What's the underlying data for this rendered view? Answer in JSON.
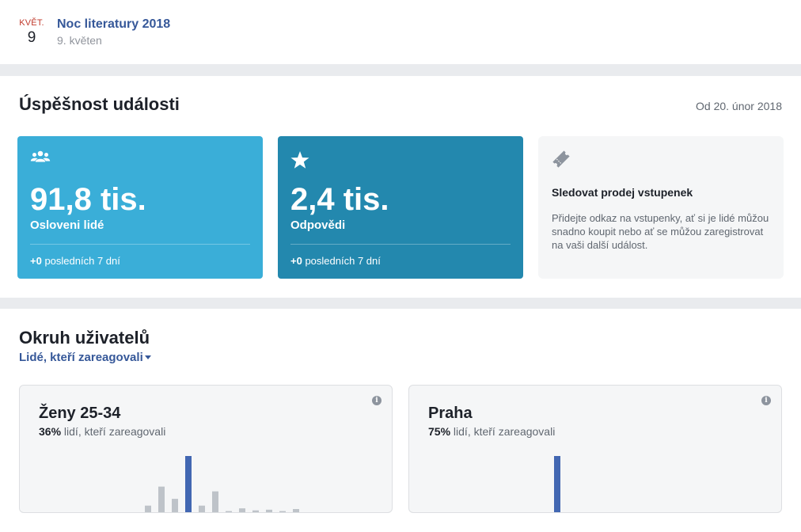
{
  "event": {
    "month": "KVĚT.",
    "day": "9",
    "title": "Noc literatury 2018",
    "subtitle": "9. květen"
  },
  "success": {
    "title": "Úspěšnost události",
    "since": "Od 20. únor 2018",
    "metrics": [
      {
        "icon": "people-icon",
        "value": "91,8 tis.",
        "label": "Osloveni lidé",
        "delta": "+0",
        "period": "posledních 7 dní",
        "color": "#3aaed8"
      },
      {
        "icon": "star-icon",
        "value": "2,4 tis.",
        "label": "Odpovědi",
        "delta": "+0",
        "period": "posledních 7 dní",
        "color": "#2388ae"
      }
    ],
    "tickets": {
      "icon": "ticket-icon",
      "title": "Sledovat prodej vstupenek",
      "text": "Přidejte odkaz na vstupenky, ať si je lidé můžou snadno koupit nebo ať se můžou zaregistrovat na vaši další událost."
    }
  },
  "audience": {
    "title": "Okruh uživatelů",
    "filter": "Lidé, kteří zareagovali",
    "cards": [
      {
        "title": "Ženy 25-34",
        "percent": "36%",
        "suffix": "lidí, kteří zareagovali"
      },
      {
        "title": "Praha",
        "percent": "75%",
        "suffix": "lidí, kteří zareagovali"
      }
    ],
    "colors": {
      "highlight": "#4267b2",
      "bar": "#bec3c9"
    }
  },
  "chart_data": [
    {
      "type": "bar",
      "title": "Ženy 25-34",
      "values": [
        1,
        1,
        12,
        40,
        22,
        85,
        12,
        33,
        4,
        8,
        5,
        6,
        4,
        7
      ],
      "highlight_index": 5
    },
    {
      "type": "bar",
      "title": "Praha",
      "values": [
        85,
        1,
        1,
        1,
        1,
        1
      ],
      "highlight_index": 0
    }
  ]
}
